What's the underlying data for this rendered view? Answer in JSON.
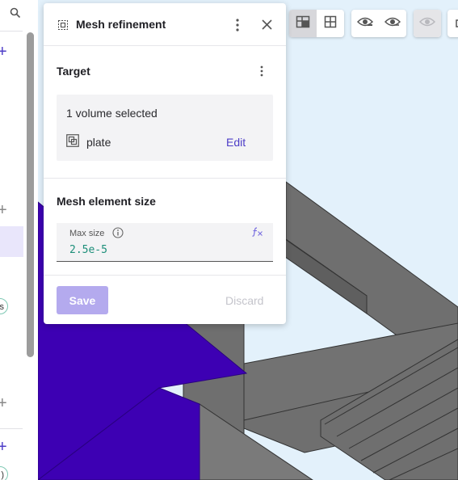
{
  "panel": {
    "title": "Mesh refinement",
    "target": {
      "heading": "Target",
      "selection_count": "1 volume selected",
      "item_name": "plate",
      "edit_label": "Edit"
    },
    "mesh": {
      "heading": "Mesh element size",
      "max_size_label": "Max size",
      "max_size_value": "2.5e-5"
    },
    "save_label": "Save",
    "discard_label": "Discard"
  },
  "sidebar": {
    "chip_1": "s",
    "chip_2": ")"
  },
  "toolbar": {
    "groups": [
      [
        "face-view-icon",
        "grid-view-icon"
      ],
      [
        "hide-icon",
        "show-icon"
      ],
      [
        "visibility-disabled-icon"
      ],
      [
        "export-icon"
      ]
    ]
  },
  "colors": {
    "accent": "#4d3dc7",
    "save_button": "#b4aaee",
    "selected_volume": "#3d00b3",
    "mesh_geometry": "#6f6f6f",
    "viewport_bg": "#e3f1fb",
    "value_text": "#1d8f7a"
  }
}
